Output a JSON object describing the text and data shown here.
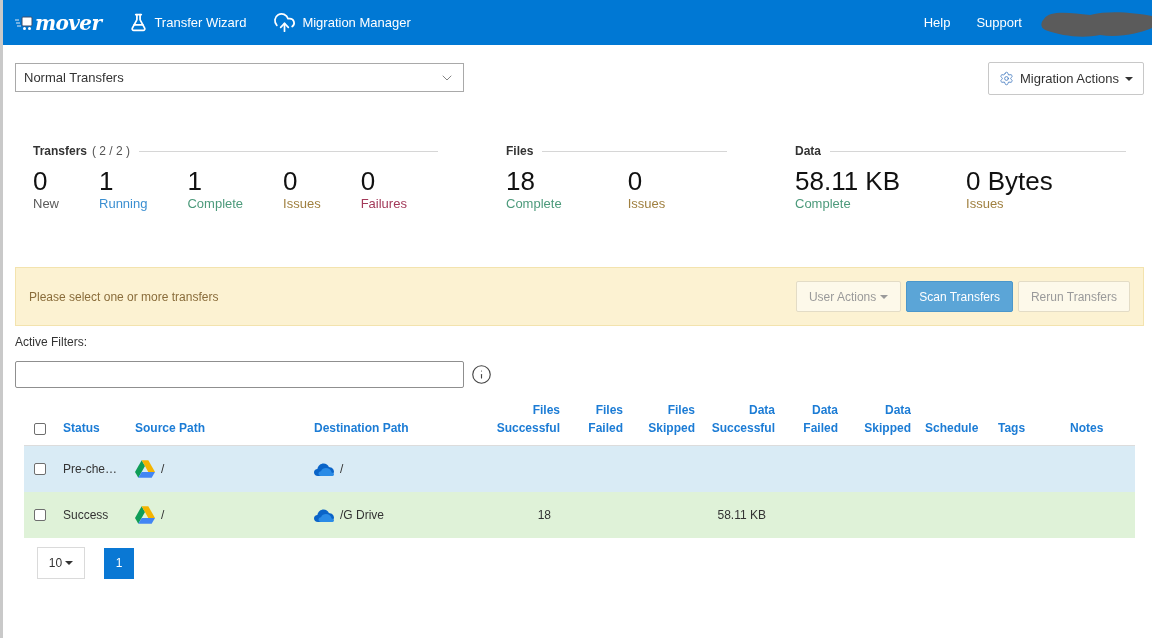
{
  "navbar": {
    "logo": "mover",
    "links": [
      {
        "label": "Transfer Wizard",
        "kind": "flask"
      },
      {
        "label": "Migration Manager",
        "kind": "cloud-upload"
      }
    ],
    "right_links": [
      {
        "label": "Help"
      },
      {
        "label": "Support"
      }
    ]
  },
  "toolbar": {
    "transfer_type": {
      "value": "Normal Transfers"
    },
    "migration_actions": {
      "label": "Migration Actions"
    }
  },
  "stats": [
    {
      "title": "Transfers",
      "count": "( 2 / 2 )",
      "items": [
        {
          "value": "0",
          "label": "New",
          "color": "#5a5a5a"
        },
        {
          "value": "1",
          "label": "Running",
          "color": "#3b8fd1"
        },
        {
          "value": "1",
          "label": "Complete",
          "color": "#4c9a7b"
        },
        {
          "value": "0",
          "label": "Issues",
          "color": "#a08040"
        },
        {
          "value": "0",
          "label": "Failures",
          "color": "#a33a5a"
        }
      ]
    },
    {
      "title": "Files",
      "items": [
        {
          "value": "18",
          "label": "Complete",
          "color": "#4c9a7b"
        },
        {
          "value": "0",
          "label": "Issues",
          "color": "#a08040"
        }
      ]
    },
    {
      "title": "Data",
      "items": [
        {
          "value": "58.11 KB",
          "label": "Complete",
          "color": "#4c9a7b"
        },
        {
          "value": "0 Bytes",
          "label": "Issues",
          "color": "#a08040"
        }
      ]
    }
  ],
  "notice": {
    "message": "Please select one or more transfers",
    "buttons": [
      {
        "label": "User Actions",
        "kind": "dropdown",
        "disabled": true
      },
      {
        "label": "Scan Transfers",
        "kind": "primary",
        "disabled": false
      },
      {
        "label": "Rerun Transfers",
        "kind": "default",
        "disabled": true
      }
    ]
  },
  "filters": {
    "label": "Active Filters:"
  },
  "table": {
    "select_all": {
      "checked": false
    },
    "columns": [
      {
        "label": "Status",
        "kind": "text"
      },
      {
        "label": "Source Path",
        "kind": "drive"
      },
      {
        "label": "Destination Path",
        "kind": "cloud"
      },
      {
        "label": "Files Successful",
        "kind": "number"
      },
      {
        "label": "Files Failed",
        "kind": "number"
      },
      {
        "label": "Files Skipped",
        "kind": "number"
      },
      {
        "label": "Data Successful",
        "kind": "number"
      },
      {
        "label": "Data Failed",
        "kind": "number"
      },
      {
        "label": "Data Skipped",
        "kind": "number"
      },
      {
        "label": "Schedule",
        "kind": "text"
      },
      {
        "label": "Tags",
        "kind": "text"
      },
      {
        "label": "Notes",
        "kind": "text"
      }
    ],
    "rows": [
      {
        "checked": false,
        "color": "#d9ebf5",
        "status": "Pre-che…",
        "source_path": "/",
        "destination_path": "/"
      },
      {
        "checked": false,
        "color": "#dff2d8",
        "status": "Success",
        "source_path": "/",
        "destination_path": "/G Drive",
        "files_successful": "18",
        "data_successful": "58.11 KB"
      }
    ]
  },
  "pagination": {
    "page_size": "10",
    "pages": [
      {
        "label": "1",
        "selected": true
      }
    ]
  }
}
